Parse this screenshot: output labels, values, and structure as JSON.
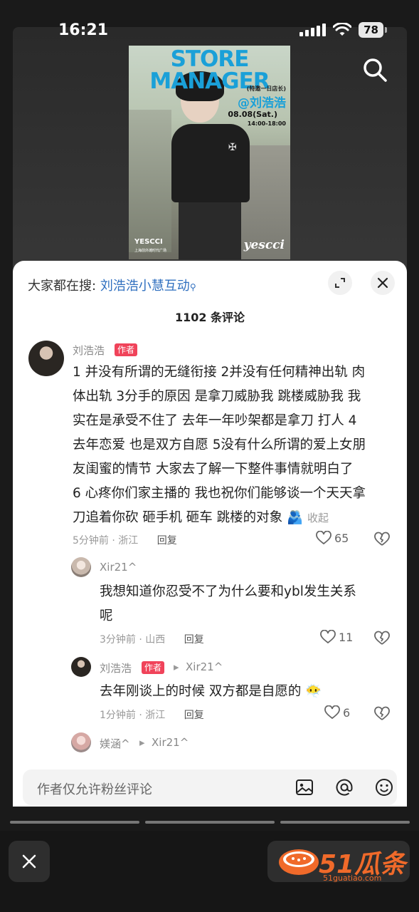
{
  "status_bar": {
    "time": "16:21",
    "battery": "78"
  },
  "poster": {
    "title": "STORE MANAGER",
    "subtitle": "(特邀一日店长)",
    "tag": "@刘浩浩",
    "date": "08.08(Sat.)",
    "time": "14:00-18:00",
    "brand": "YESCCI",
    "brand_sub": "上海前外滩时代广场",
    "script": "yescci",
    "logo": "✠"
  },
  "sheet": {
    "search_prefix": "大家都在搜:",
    "search_keyword": "刘浩浩小慧互动",
    "search_mag": "⚲",
    "comment_count": "1102 条评论"
  },
  "comments": [
    {
      "user": "刘浩浩",
      "badge": "作者",
      "lines": [
        "1 并没有所谓的无缝衔接 2并没有任何精神出轨 肉",
        "体出轨 3分手的原因 是拿刀威胁我 跳楼威胁我 我",
        "实在是承受不住了 去年一年吵架都是拿刀 打人 4",
        "去年恋爱 也是双方自愿 5没有什么所谓的爱上女朋",
        "友闺蜜的情节 大家去了解一下整件事情就明白了",
        "6 心疼你们家主播的 我也祝你们能够谈一个天天拿",
        "刀追着你砍 砸手机 砸车 跳楼的对象"
      ],
      "emoji": "🫂",
      "fold": "收起",
      "meta": "5分钟前 · 浙江",
      "reply": "回复",
      "likes": "65"
    },
    {
      "user": "Xir21^",
      "lines": [
        "我想知道你忍受不了为什么要和ybl发生关系",
        "呢"
      ],
      "meta": "3分钟前 · 山西",
      "reply": "回复",
      "likes": "11"
    },
    {
      "user": "刘浩浩",
      "badge": "作者",
      "arrow": "▸",
      "reply_to": "Xir21^",
      "lines": [
        "去年刚谈上的时候 双方都是自愿的"
      ],
      "emoji": "😶‍🌫️",
      "meta": "1分钟前 · 浙江",
      "reply": "回复",
      "likes": "6"
    },
    {
      "user": "媄涵^",
      "arrow": "▸",
      "reply_to": "Xir21^"
    }
  ],
  "input": {
    "placeholder": "作者仅允许粉丝评论"
  },
  "watermark": {
    "text": "51瓜条",
    "url": "51guatiao.com"
  },
  "colors": {
    "accent": "#f0435a",
    "link": "#2f6fbf",
    "watermark": "#f06a2a"
  }
}
